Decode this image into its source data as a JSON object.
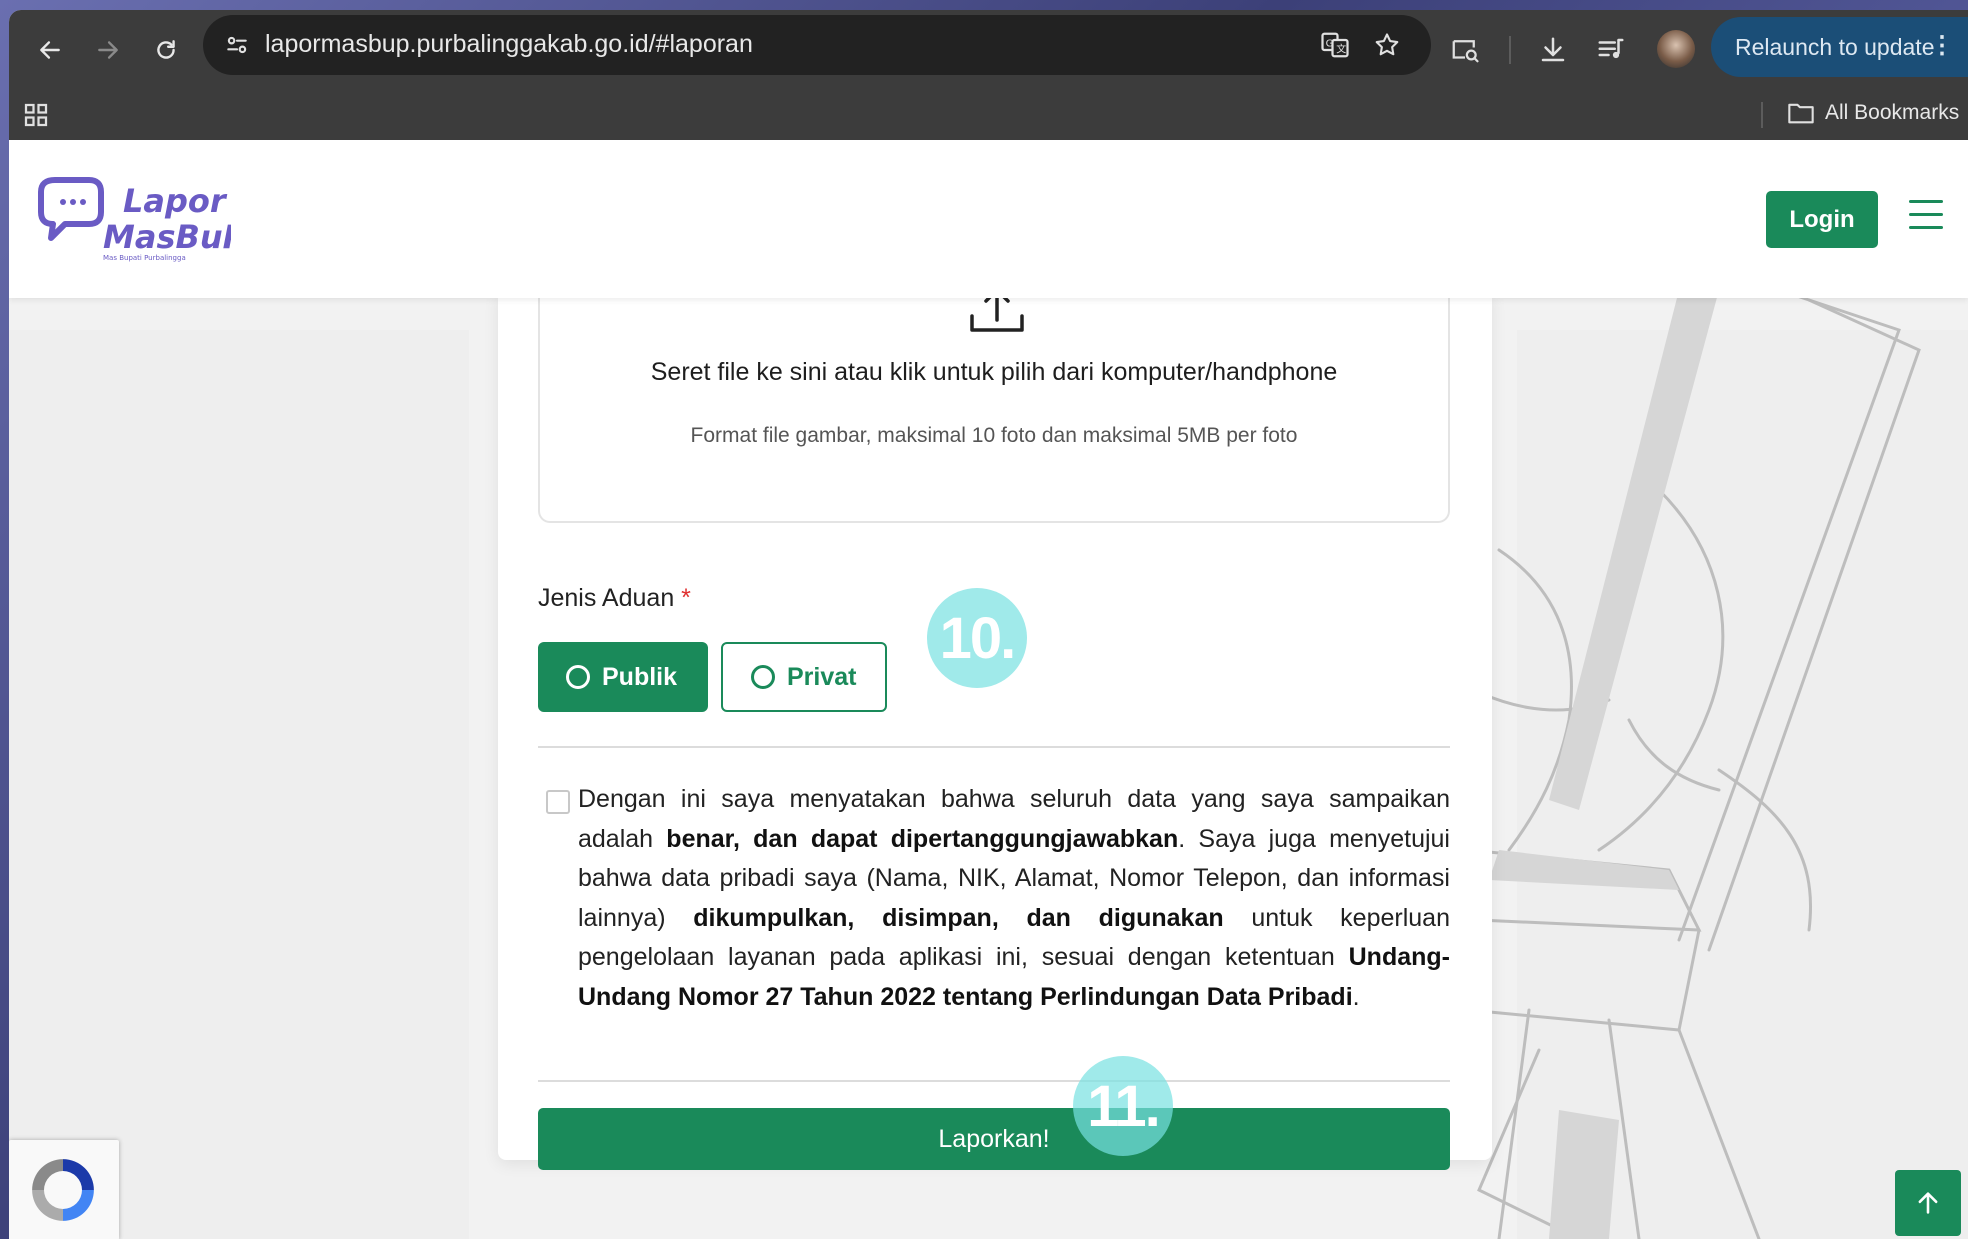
{
  "browser": {
    "url": "lapormasbup.purbalinggakab.go.id/#laporan",
    "relaunch_label": "Relaunch to update",
    "all_bookmarks_label": "All Bookmarks"
  },
  "header": {
    "logo_line1": "Lapor",
    "logo_line2": "MasBuP",
    "logo_tagline": "Mas Bupati Purbalingga",
    "login_label": "Login"
  },
  "upload": {
    "title": "Seret file ke sini atau klik untuk pilih dari komputer/handphone",
    "subtitle": "Format file gambar, maksimal 10 foto dan maksimal 5MB per foto"
  },
  "jenis_aduan": {
    "label": "Jenis Aduan",
    "required_mark": "*",
    "options": [
      "Publik",
      "Privat"
    ],
    "selected": "Publik"
  },
  "consent": {
    "part1": "Dengan ini saya menyatakan bahwa seluruh data yang saya sampaikan adalah ",
    "bold1": "benar, dan dapat dipertanggungjawabkan",
    "part2": ". Saya juga menyetujui bahwa data pribadi saya (Nama, NIK, Alamat, Nomor Telepon, dan informasi lainnya) ",
    "bold2": "dikumpulkan, disimpan, dan digunakan",
    "part3": " untuk keperluan pengelolaan layanan pada aplikasi ini, sesuai dengan ketentuan ",
    "bold3": "Undang-Undang Nomor 27 Tahun 2022 tentang Perlindungan Data Pribadi",
    "part4": "."
  },
  "submit_label": "Laporkan!",
  "annotations": {
    "step10": "10.",
    "step11": "11."
  },
  "colors": {
    "brand_green": "#1a8a5a",
    "logo_purple": "#6a5bc4",
    "badge_cyan": "#78e1e1"
  }
}
